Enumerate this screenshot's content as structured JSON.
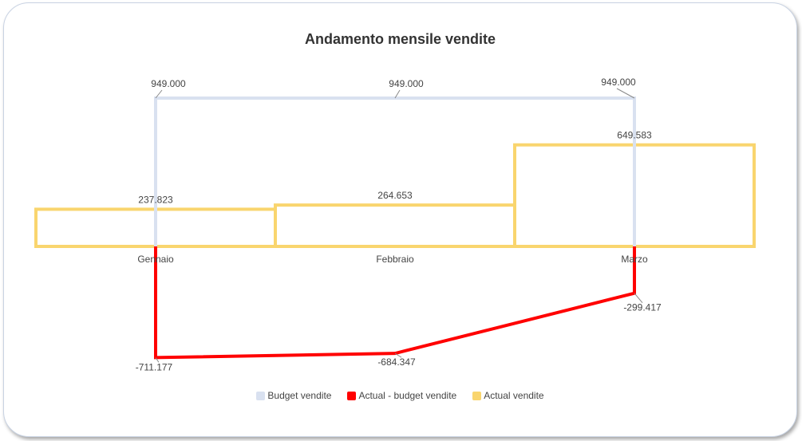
{
  "chart_data": {
    "type": "line",
    "title": "Andamento mensile vendite",
    "categories": [
      "Gennaio",
      "Febbraio",
      "Marzo"
    ],
    "series": [
      {
        "name": "Budget vendite",
        "values": [
          949000,
          949000,
          949000
        ],
        "labels": [
          "949.000",
          "949.000",
          "949.000"
        ],
        "color": "#d9e1f0"
      },
      {
        "name": "Actual - budget vendite",
        "values": [
          -711177,
          -684347,
          -299417
        ],
        "labels": [
          "-711.177",
          "-684.347",
          "-299.417"
        ],
        "color": "#ff0000"
      },
      {
        "name": "Actual vendite",
        "values": [
          237823,
          264653,
          649583
        ],
        "labels": [
          "237.823",
          "264.653",
          "649.583"
        ],
        "color": "#f9d56e"
      }
    ],
    "legend_position": "bottom",
    "grid": false
  }
}
